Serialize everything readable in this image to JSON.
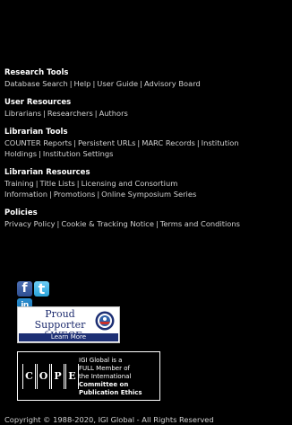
{
  "colors": {
    "background": "#000000",
    "heading": "#ffffff",
    "link": "#d2d2d2",
    "facebook": "#3b5998",
    "twitter": "#55acee",
    "linkedin": "#0e76a8",
    "wfcf_blue": "#1d2f74"
  },
  "sections": [
    {
      "title": "Research Tools",
      "links": [
        "Database Search",
        "Help",
        "User Guide",
        "Advisory Board"
      ]
    },
    {
      "title": "User Resources",
      "links": [
        "Librarians",
        "Researchers",
        "Authors"
      ]
    },
    {
      "title": "Librarian Tools",
      "links": [
        "COUNTER Reports",
        "Persistent URLs",
        "MARC Records",
        "Institution Holdings",
        "Institution Settings"
      ]
    },
    {
      "title": "Librarian Resources",
      "links": [
        "Training",
        "Title Lists",
        "Licensing and Consortium Information",
        "Promotions",
        "Online Symposium Series"
      ]
    },
    {
      "title": "Policies",
      "links": [
        "Privacy Policy",
        "Cookie & Tracking Notice",
        "Terms and Conditions"
      ]
    }
  ],
  "separator": "|",
  "social": {
    "facebook_icon": "facebook-icon",
    "facebook_glyph": "f",
    "twitter_icon": "twitter-icon",
    "twitter_glyph": "t",
    "linkedin_icon": "linkedin-icon",
    "linkedin_glyph": "in"
  },
  "wfcf": {
    "line1": "Proud Supporter",
    "line2": "of WFCF",
    "learn_more": "Learn More"
  },
  "cope": {
    "letters": [
      "C",
      "O",
      "P",
      "E"
    ],
    "line1": "IGI Global is a",
    "line2": "FULL Member of",
    "line3": "the International",
    "line4": "Committee on",
    "line5": "Publication Ethics"
  },
  "copyright": "Copyright © 1988-2020, IGI Global - All Rights Reserved"
}
